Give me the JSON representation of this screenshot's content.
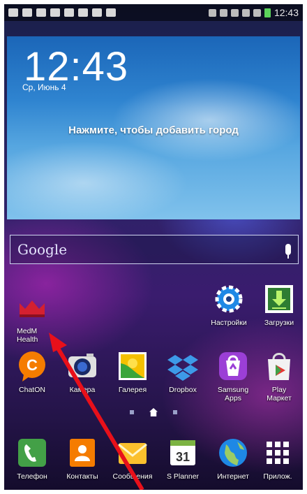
{
  "status_bar": {
    "time": "12:43",
    "left_icons": [
      "gallery-icon",
      "mail-icon",
      "cloud-icon",
      "download-icon",
      "check-icon",
      "check-icon",
      "check-icon",
      "briefcase-icon"
    ],
    "right_icons": [
      "eye-icon",
      "bluetooth-icon",
      "mute-icon",
      "wifi-icon",
      "signal-icon",
      "battery-icon"
    ]
  },
  "weather": {
    "time": "12:43",
    "date": "Ср, Июнь 4",
    "prompt": "Нажмите, чтобы добавить город"
  },
  "google_search": {
    "logo": "Google",
    "mic_icon": "mic-icon"
  },
  "apps": [
    {
      "key": "medm",
      "label": "MedM\nHealth",
      "icon": "medm-crown-icon"
    },
    {
      "key": "settings",
      "label": "Настройки",
      "icon": "gear-icon"
    },
    {
      "key": "downloads",
      "label": "Загрузки",
      "icon": "download-arrow-icon"
    },
    {
      "key": "chaton",
      "label": "ChatON",
      "icon": "chaton-icon"
    },
    {
      "key": "camera",
      "label": "Камера",
      "icon": "camera-icon"
    },
    {
      "key": "gallery",
      "label": "Галерея",
      "icon": "flower-icon"
    },
    {
      "key": "dropbox",
      "label": "Dropbox",
      "icon": "dropbox-icon"
    },
    {
      "key": "samsung_apps",
      "label": "Samsung\nApps",
      "icon": "samsung-apps-icon"
    },
    {
      "key": "play",
      "label": "Play\nМаркет",
      "icon": "play-store-icon"
    }
  ],
  "dock": [
    {
      "key": "phone",
      "label": "Телефон",
      "icon": "phone-icon"
    },
    {
      "key": "contacts",
      "label": "Контакты",
      "icon": "contacts-icon"
    },
    {
      "key": "messages",
      "label": "Сообщения",
      "icon": "envelope-icon"
    },
    {
      "key": "splanner",
      "label": "S Planner",
      "icon": "calendar-icon",
      "day": "31"
    },
    {
      "key": "internet",
      "label": "Интернет",
      "icon": "globe-icon"
    },
    {
      "key": "apps",
      "label": "Прилож.",
      "icon": "grid-icon"
    }
  ],
  "colors": {
    "accent_arrow": "#e8101a",
    "battery": "#5bd35b"
  }
}
